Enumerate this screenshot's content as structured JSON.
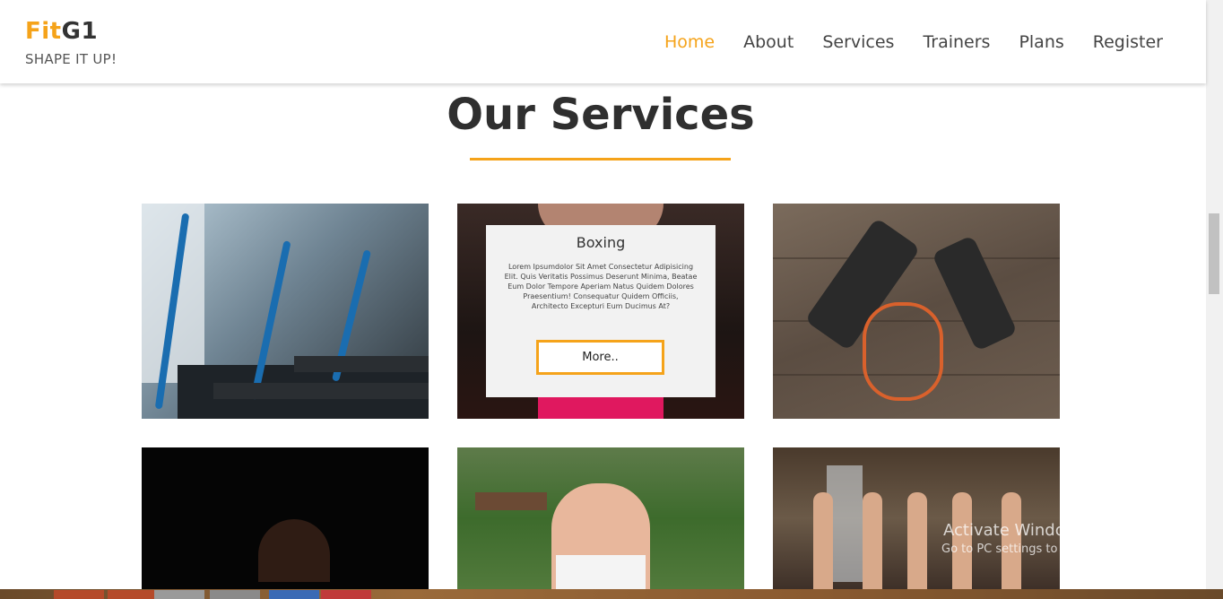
{
  "brand": {
    "part1": "Fit",
    "part2": "G1",
    "tagline": "SHAPE IT UP!"
  },
  "nav": [
    {
      "label": "Home",
      "active": true
    },
    {
      "label": "About",
      "active": false
    },
    {
      "label": "Services",
      "active": false
    },
    {
      "label": "Trainers",
      "active": false
    },
    {
      "label": "Plans",
      "active": false
    },
    {
      "label": "Register",
      "active": false
    }
  ],
  "section": {
    "title": "Our Services"
  },
  "services": {
    "boxing": {
      "title": "Boxing",
      "text": "Lorem Ipsumdolor Sit Amet Consectetur Adipisicing Elit. Quis Veritatis Possimus Deserunt Minima, Beatae Eum Dolor Tempore Aperiam Natus Quidem Dolores Praesentium! Consequatur Quidem Officiis, Architecto Excepturi Eum Ducimus At?",
      "button": "More.."
    }
  },
  "watermark": {
    "line1": "Activate Windows",
    "line2": "Go to PC settings to activate Windows."
  },
  "colors": {
    "accent": "#f5a31a",
    "text": "#333333"
  }
}
